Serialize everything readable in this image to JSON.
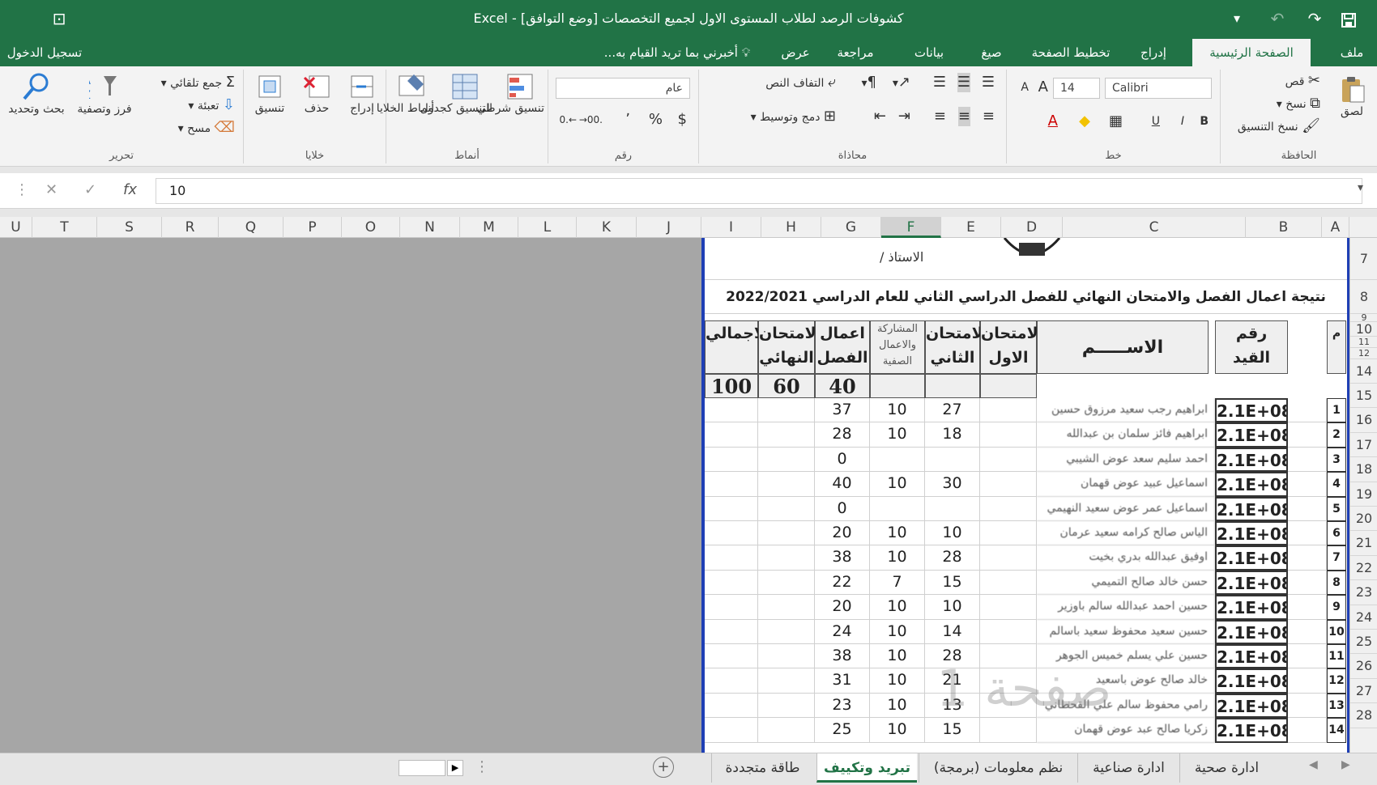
{
  "window": {
    "title": "Excel - [وضع التوافق] كشوفات الرصد لطلاب المستوى الاول لجميع التخصصات",
    "sign_in": "تسجيل الدخول"
  },
  "ribbon_tabs": [
    "ملف",
    "الصفحة الرئيسية",
    "إدراج",
    "تخطيط الصفحة",
    "صيغ",
    "بيانات",
    "مراجعة",
    "عرض"
  ],
  "tell_me": "أخبرني بما تريد القيام به...",
  "ribbon": {
    "clipboard": {
      "label": "الحافظة",
      "paste": "لصق",
      "cut": "قص",
      "copy": "نسخ",
      "format_painter": "نسخ التنسيق"
    },
    "font": {
      "label": "خط",
      "name": "Calibri",
      "size": "14",
      "bold": "B",
      "italic": "I",
      "underline": "U"
    },
    "alignment": {
      "label": "محاذاة",
      "wrap": "التفاف النص",
      "merge": "دمج وتوسيط"
    },
    "number": {
      "label": "رقم",
      "format": "عام",
      "currency": "$",
      "percent": "%",
      "comma": "٬"
    },
    "styles": {
      "label": "أنماط",
      "conditional": "تنسيق شرطي",
      "as_table": "التنسيق كجدول",
      "cell_styles": "أنماط الخلايا"
    },
    "cells": {
      "label": "خلايا",
      "insert": "إدراج",
      "delete": "حذف",
      "format": "تنسيق"
    },
    "editing": {
      "label": "تحرير",
      "autosum": "جمع تلقائي",
      "fill": "تعبئة",
      "clear": "مسح",
      "sort": "فرز وتصفية",
      "find": "بحث وتحديد"
    }
  },
  "formula_bar": {
    "value": "10",
    "fx": "fx"
  },
  "columns": [
    "A",
    "B",
    "C",
    "D",
    "E",
    "F",
    "G",
    "H",
    "I",
    "J",
    "K",
    "L",
    "M",
    "N",
    "O",
    "P",
    "Q",
    "R",
    "S",
    "T",
    "U"
  ],
  "selected_column": "F",
  "row_numbers": [
    "7",
    "8",
    "9",
    "10",
    "11",
    "12",
    "14",
    "15",
    "16",
    "17",
    "18",
    "19",
    "20",
    "21",
    "22",
    "23",
    "24",
    "25",
    "26",
    "27",
    "28"
  ],
  "sheet": {
    "teacher_label": "الاستاذ /",
    "heading": "نتيجة اعمال الفصل والامتحان النهائي  للفصل الدراسي الثاني  للعام الدراسي 2022/2021",
    "headers": {
      "serial": "م",
      "id": "رقم القيد",
      "name": "الاســـــم",
      "exam1": "الامتحان الاول",
      "exam2": "الامتحان الثاني",
      "participation": "المشاركة والاعمال الصفية",
      "coursework": "اعمال الفصل",
      "final": "الامتحان النهائي",
      "total": "الاجمالي"
    },
    "max_marks": {
      "coursework": "40",
      "final": "60",
      "total": "100"
    },
    "rows": [
      {
        "n": "1",
        "id": "2.1E+08",
        "name": "ابراهيم رجب سعيد مرزوق حسين",
        "exam2": "27",
        "part": "10",
        "cw": "37"
      },
      {
        "n": "2",
        "id": "2.1E+08",
        "name": "ابراهيم فائز سلمان بن عبدالله",
        "exam2": "18",
        "part": "10",
        "cw": "28"
      },
      {
        "n": "3",
        "id": "2.1E+08",
        "name": "احمد سليم سعد عوض الشيبي",
        "exam2": "",
        "part": "",
        "cw": "0"
      },
      {
        "n": "4",
        "id": "2.1E+08",
        "name": "اسماعيل عبيد عوض قهمان",
        "exam2": "30",
        "part": "10",
        "cw": "40"
      },
      {
        "n": "5",
        "id": "2.1E+08",
        "name": "اسماعيل عمر عوض سعيد النهيمي",
        "exam2": "",
        "part": "",
        "cw": "0"
      },
      {
        "n": "6",
        "id": "2.1E+08",
        "name": "الياس صالح كرامه سعيد عرمان",
        "exam2": "10",
        "part": "10",
        "cw": "20"
      },
      {
        "n": "7",
        "id": "2.1E+08",
        "name": "اوفيق عبدالله بدري بخيت",
        "exam2": "28",
        "part": "10",
        "cw": "38"
      },
      {
        "n": "8",
        "id": "2.1E+08",
        "name": "حسن خالد صالح التميمي",
        "exam2": "15",
        "part": "7",
        "cw": "22"
      },
      {
        "n": "9",
        "id": "2.1E+08",
        "name": "حسين احمد عبدالله سالم باوزير",
        "exam2": "10",
        "part": "10",
        "cw": "20"
      },
      {
        "n": "10",
        "id": "2.1E+08",
        "name": "حسين سعيد محفوظ سعيد باسالم",
        "exam2": "14",
        "part": "10",
        "cw": "24"
      },
      {
        "n": "11",
        "id": "2.1E+08",
        "name": "حسين علي يسلم خميس الجوهر",
        "exam2": "28",
        "part": "10",
        "cw": "38"
      },
      {
        "n": "12",
        "id": "2.1E+08",
        "name": "خالد صالح عوض باسعيد",
        "exam2": "21",
        "part": "10",
        "cw": "31"
      },
      {
        "n": "13",
        "id": "2.1E+08",
        "name": "رامي محفوظ سالم علي القحطاني",
        "exam2": "13",
        "part": "10",
        "cw": "23"
      },
      {
        "n": "14",
        "id": "2.1E+08",
        "name": "زكريا صالح عبد عوض قهمان",
        "exam2": "15",
        "part": "10",
        "cw": "25"
      }
    ],
    "watermark": "صفحة 1"
  },
  "sheet_tabs": [
    "ادارة صحية",
    "ادارة صناعية",
    "نظم معلومات (برمجة)",
    "تبريد وتكييف",
    "طاقة متجددة"
  ],
  "active_sheet": "تبريد وتكييف",
  "colors": {
    "excel_green": "#217346",
    "page_border": "#1f3fb5"
  }
}
